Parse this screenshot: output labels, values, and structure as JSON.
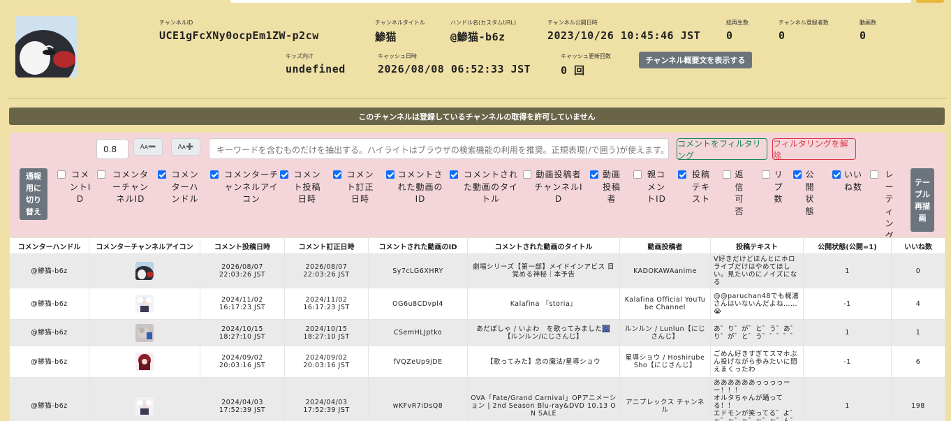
{
  "channel": {
    "id_label": "チャンネルID",
    "id": "UCE1gFcXNy0ocpEm1ZW-p2cw",
    "title_label": "チャンネルタイトル",
    "title": "鯵猫",
    "handle_label": "ハンドル名(カスタムURL)",
    "handle": "@鯵猫-b6z",
    "published_label": "チャンネル公開日時",
    "published": "2023/10/26 10:45:46 JST",
    "views_label": "総再生数",
    "views": "0",
    "subs_label": "チャンネル登録者数",
    "subs": "0",
    "videos_label": "動画数",
    "videos": "0",
    "kids_label": "キッズ向け",
    "kids": "undefined",
    "cache_label": "キャッシュ日時",
    "cache": "2026/08/08 06:52:33 JST",
    "cache_count_label": "キャッシュ更新回数",
    "cache_count": "0 回",
    "desc_button": "チャンネル概要文を表示する"
  },
  "notice": "このチャンネルは登録しているチャンネルの取得を許可していません",
  "controls": {
    "font_scale": "0.8",
    "font_down": "Aᴀ➖",
    "font_up": "Aᴀ➕",
    "keyword_placeholder": "キーワードを含むものだけを抽出する。ハイライトはブラウザの検索機能の利用を推奨。正規表現(/で囲う)が使えます。(e.g. /(BC)A",
    "filter_button": "コメントをフィルタリング",
    "clear_button": "フィルタリングを解除",
    "report_toggle": "通報用に切り替え",
    "redraw": "テーブル再描画"
  },
  "columns": [
    {
      "label": "コメントID",
      "checked": false
    },
    {
      "label": "コメンターチャンネルID",
      "checked": false
    },
    {
      "label": "コメンターハンドル",
      "checked": true
    },
    {
      "label": "コメンターチャンネルアイコン",
      "checked": true
    },
    {
      "label": "コメント投稿日時",
      "checked": true
    },
    {
      "label": "コメント訂正日時",
      "checked": true
    },
    {
      "label": "コメントされた動画のID",
      "checked": true
    },
    {
      "label": "コメントされた動画のタイトル",
      "checked": true
    },
    {
      "label": "動画投稿者チャンネルID",
      "checked": false
    },
    {
      "label": "動画投稿者",
      "checked": true
    },
    {
      "label": "親コメントID",
      "checked": false
    },
    {
      "label": "投稿テキスト",
      "checked": true
    },
    {
      "label": "返信可否",
      "checked": false
    },
    {
      "label": "リプ数",
      "checked": false
    },
    {
      "label": "公開状態",
      "checked": true
    },
    {
      "label": "いいね数",
      "checked": true
    },
    {
      "label": "レーティング",
      "checked": false
    }
  ],
  "table": {
    "headers": [
      "コメンターハンドル",
      "コメンターチャンネルアイコン",
      "コメント投稿日時",
      "コメント訂正日時",
      "コメントされた動画のID",
      "コメントされた動画のタイトル",
      "動画投稿者",
      "投稿テキスト",
      "公開状態(公開=1)",
      "いいね数"
    ],
    "rows": [
      {
        "handle": "@鯵猫-b6z",
        "icon": "penguin-avatar-icon",
        "posted": "2026/08/07\n22:03:26 JST",
        "edited": "2026/08/07\n22:03:26 JST",
        "video_id": "Sy7cLG6XHRY",
        "video_title": "劇場シリーズ【第一部】メイドインアビス 目覚める神秘｜本予告",
        "uploader": "KADOKAWAanime",
        "text": "V好きだけどほんとにホロライブだけはやめてほしい。見たいのにノイズになる",
        "status": "1",
        "likes": "0"
      },
      {
        "handle": "@鯵猫-b6z",
        "icon": "white-hair-avatar-icon",
        "posted": "2024/11/02\n16:17:23 JST",
        "edited": "2024/11/02\n16:17:23 JST",
        "video_id": "OG6u8CDvpl4",
        "video_title": "Kalafina 『storia』",
        "uploader": "Kalafina Official YouTube Channel",
        "text": "@@paruchan48でも梶浦さんはいないんだよね……😭",
        "status": "-1",
        "likes": "4"
      },
      {
        "handle": "@鯵猫-b6z",
        "icon": "blue-ribbon-avatar-icon",
        "posted": "2024/10/15\n18:27:10 JST",
        "edited": "2024/10/15\n18:27:10 JST",
        "video_id": "CSemHLJptko",
        "video_title": "あだぽしゃ / いよわ　を歌ってみました🎆【ルンルン/にじさんじ】",
        "uploader": "ルンルン / Lunlun【にじさんじ】",
        "text": "あ゛り゛が゛と゛う゛あ゛り゛が゛と゛う゛゛゛゛゛",
        "status": "1",
        "likes": "1"
      },
      {
        "handle": "@鯵猫-b6z",
        "icon": "red-hair-avatar-icon",
        "posted": "2024/09/02\n20:03:16 JST",
        "edited": "2024/09/02\n20:03:16 JST",
        "video_id": "fVQZeUp9jDE",
        "video_title": "【歌ってみた】恋の魔法/星導ショウ",
        "uploader": "星導ショウ / Hoshirube Sho【にじさんじ】",
        "text": "ごめん好きすぎてスマホぶん投げながら歩みたいに悶えまくったわ",
        "status": "-1",
        "likes": "6"
      },
      {
        "handle": "@鯵猫-b6z",
        "icon": "white-hair-avatar-icon",
        "posted": "2024/04/03\n17:52:39 JST",
        "edited": "2024/04/03\n17:52:39 JST",
        "video_id": "wKFvR7iDsQ8",
        "video_title": "OVA「Fate/Grand Carnival」OPアニメーション | 2nd Season Blu-ray&DVD 10.13 ON SALE",
        "uploader": "アニプレックス チャンネル",
        "text": "ああああああっっっっーー！！！\nオルタちゃんが踊ってる！！\nエドモンが笑ってる゛よ゛ぉ゛ぉ゛ぉ゛ぉ゛ぉ゛ん゛（号泣）",
        "status": "1",
        "likes": "198"
      }
    ]
  }
}
